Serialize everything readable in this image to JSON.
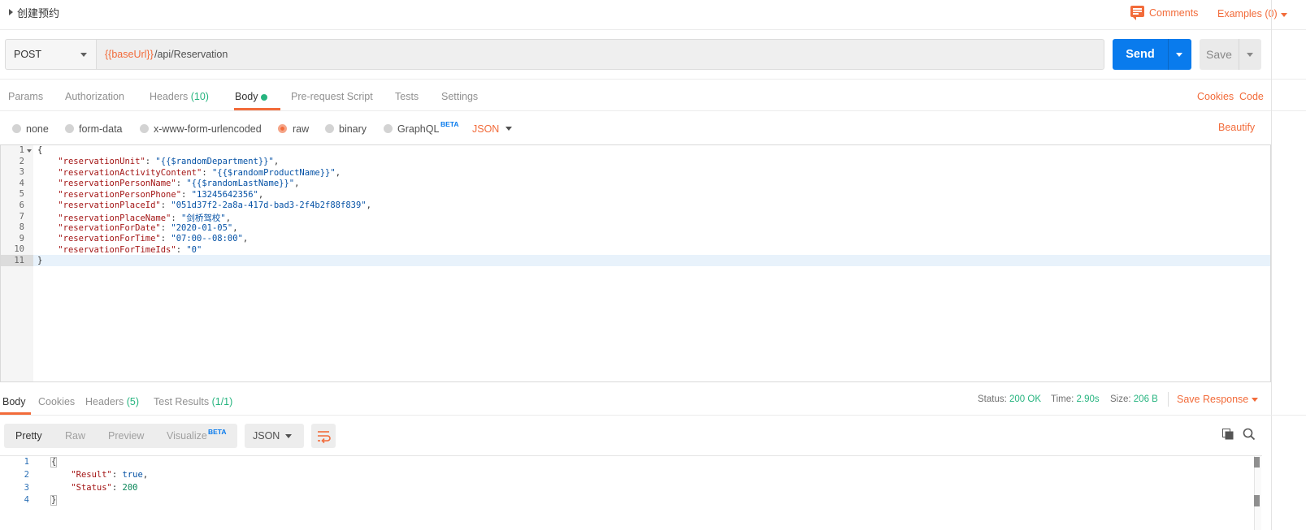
{
  "title_bar": {
    "title": "创建预约",
    "comments_label": "Comments",
    "examples_label": "Examples (0)",
    "colors": {
      "accent": "#f26b3a"
    }
  },
  "request": {
    "method": "POST",
    "url_variable": "{{baseUrl}}",
    "url_path": "/api/Reservation",
    "send_label": "Send",
    "save_label": "Save",
    "colors": {
      "send": "#097bed"
    }
  },
  "request_tabs": {
    "params": "Params",
    "authorization": "Authorization",
    "headers": "Headers",
    "headers_count": "(10)",
    "body": "Body",
    "pre_request": "Pre-request Script",
    "tests": "Tests",
    "settings": "Settings",
    "cookies": "Cookies",
    "code": "Code"
  },
  "body_types": {
    "none": "none",
    "form_data": "form-data",
    "urlencoded": "x-www-form-urlencoded",
    "raw": "raw",
    "binary": "binary",
    "graphql": "GraphQL",
    "beta": "BETA",
    "format": "JSON",
    "selected": "raw",
    "beautify": "Beautify"
  },
  "editor": {
    "line_numbers": [
      "1",
      "2",
      "3",
      "4",
      "5",
      "6",
      "7",
      "8",
      "9",
      "10",
      "11"
    ],
    "open_brace": "{",
    "close_brace": "}",
    "lines": [
      {
        "key": "\"reservationUnit\"",
        "value": "\"{{$randomDepartment}}\"",
        "comma": ","
      },
      {
        "key": "\"reservationActivityContent\"",
        "value": "\"{{$randomProductName}}\"",
        "comma": ","
      },
      {
        "key": "\"reservationPersonName\"",
        "value": "\"{{$randomLastName}}\"",
        "comma": ","
      },
      {
        "key": "\"reservationPersonPhone\"",
        "value": "\"13245642356\"",
        "comma": ","
      },
      {
        "key": "\"reservationPlaceId\"",
        "value": "\"051d37f2-2a8a-417d-bad3-2f4b2f88f839\"",
        "comma": ","
      },
      {
        "key": "\"reservationPlaceName\"",
        "value": "\"剑桥驾校\"",
        "comma": ","
      },
      {
        "key": "\"reservationForDate\"",
        "value": "\"2020-01-05\"",
        "comma": ","
      },
      {
        "key": "\"reservationForTime\"",
        "value": "\"07:00--08:00\"",
        "comma": ","
      },
      {
        "key": "\"reservationForTimeIds\"",
        "value": "\"0\"",
        "comma": ""
      }
    ]
  },
  "response_tabs": {
    "body": "Body",
    "cookies": "Cookies",
    "headers": "Headers",
    "headers_count": "(5)",
    "test_results": "Test Results",
    "test_results_count": "(1/1)"
  },
  "response_meta": {
    "status_label": "Status:",
    "status_value": "200 OK",
    "time_label": "Time:",
    "time_value": "2.90s",
    "size_label": "Size:",
    "size_value": "206 B",
    "save_response": "Save Response"
  },
  "response_view": {
    "pretty": "Pretty",
    "raw": "Raw",
    "preview": "Preview",
    "visualize": "Visualize",
    "beta": "BETA",
    "format": "JSON"
  },
  "response_body": {
    "line_numbers": [
      "1",
      "2",
      "3",
      "4"
    ],
    "open_brace": "{",
    "close_brace": "}",
    "result_key": "\"Result\"",
    "result_value": "true",
    "status_key": "\"Status\"",
    "status_value": "200"
  }
}
